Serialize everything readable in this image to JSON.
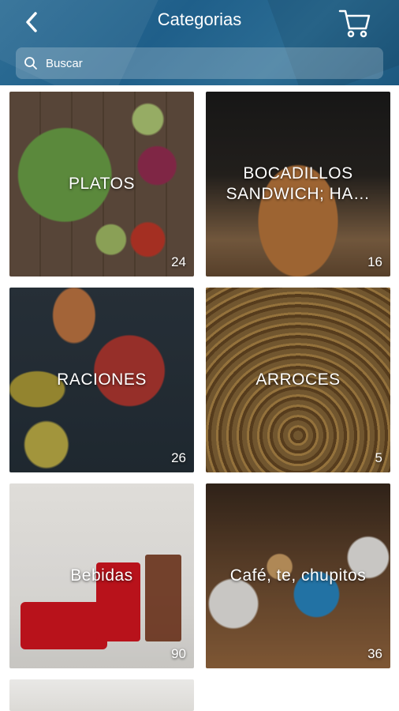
{
  "header": {
    "title": "Categorias",
    "back_icon": "chevron-left-icon",
    "cart_icon": "cart-icon"
  },
  "search": {
    "placeholder": "Buscar",
    "value": "",
    "icon": "search-icon"
  },
  "categories": [
    {
      "label": "PLATOS",
      "count": "24"
    },
    {
      "label": "BOCADILLOS SANDWICH; HA…",
      "count": "16"
    },
    {
      "label": "RACIONES",
      "count": "26"
    },
    {
      "label": "ARROCES",
      "count": "5"
    },
    {
      "label": "Bebidas",
      "count": "90"
    },
    {
      "label": "Café, te, chupitos",
      "count": "36"
    },
    {
      "label": "",
      "count": ""
    }
  ],
  "colors": {
    "header": "#2a6a92",
    "text": "#ffffff"
  }
}
